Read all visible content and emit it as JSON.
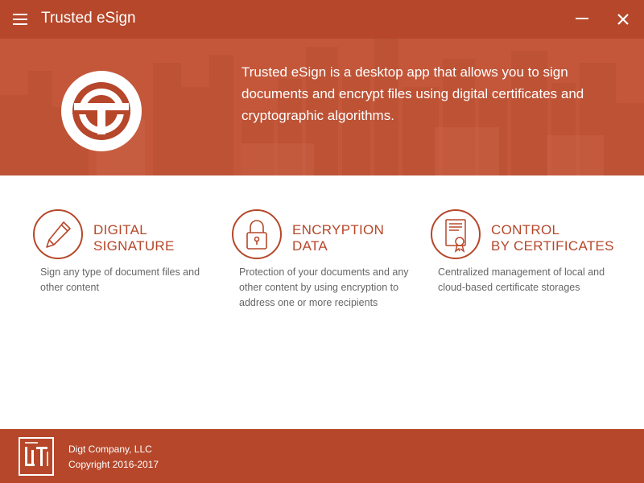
{
  "window": {
    "title": "Trusted eSign",
    "colors": {
      "brand": "#b6472a",
      "hero": "#c4573a",
      "text_muted": "#666666"
    }
  },
  "hero": {
    "description": "Trusted eSign is a desktop app that allows you to sign documents and encrypt files using digital certificates and cryptographic algorithms."
  },
  "features": [
    {
      "icon": "pen-icon",
      "title_line1": "DIGITAL",
      "title_line2": "SIGNATURE",
      "description": "Sign any type of document files and other content"
    },
    {
      "icon": "padlock-icon",
      "title_line1": "ENCRYPTION",
      "title_line2": "DATA",
      "description": "Protection of your documents and any other content by using encryption to address one or more recipients"
    },
    {
      "icon": "certificate-icon",
      "title_line1": "CONTROL",
      "title_line2": "BY CERTIFICATES",
      "description": "Centralized management of local and cloud-based certificate storages"
    }
  ],
  "footer": {
    "company": "Digt Company, LLC",
    "copyright": "Copyright 2016-2017"
  }
}
